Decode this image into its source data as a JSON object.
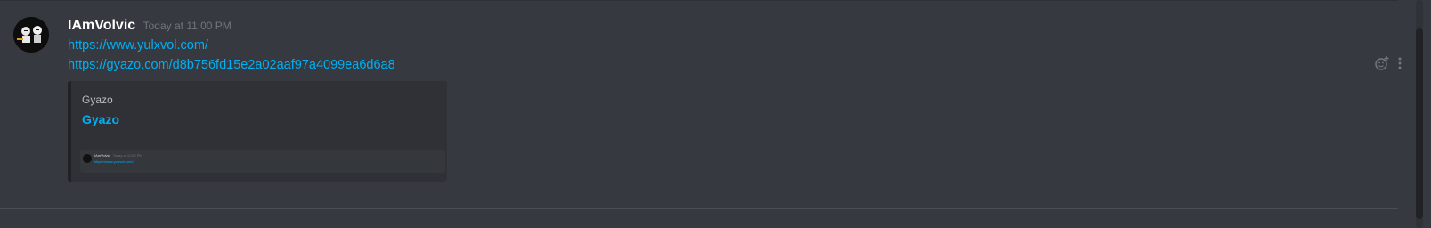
{
  "message": {
    "author": "IAmVolvic",
    "timestamp": "Today at 11:00 PM",
    "links": [
      "https://www.yulxvol.com/",
      "https://gyazo.com/d8b756fd15e2a02aaf97a4099ea6d6a8"
    ]
  },
  "embed": {
    "provider": "Gyazo",
    "title": "Gyazo",
    "thumbnail": {
      "author": "IAmVolvic",
      "timestamp": "Today at 11:00 PM",
      "link": "https://www.yulxvol.com/"
    }
  },
  "icons": {
    "avatar": "avatar-image",
    "reaction": "add-reaction-icon",
    "more": "more-options-icon"
  },
  "colors": {
    "background": "#36393f",
    "embed_background": "#2f3136",
    "link": "#00b0f4",
    "username": "#ffffff",
    "timestamp": "#72767d"
  }
}
